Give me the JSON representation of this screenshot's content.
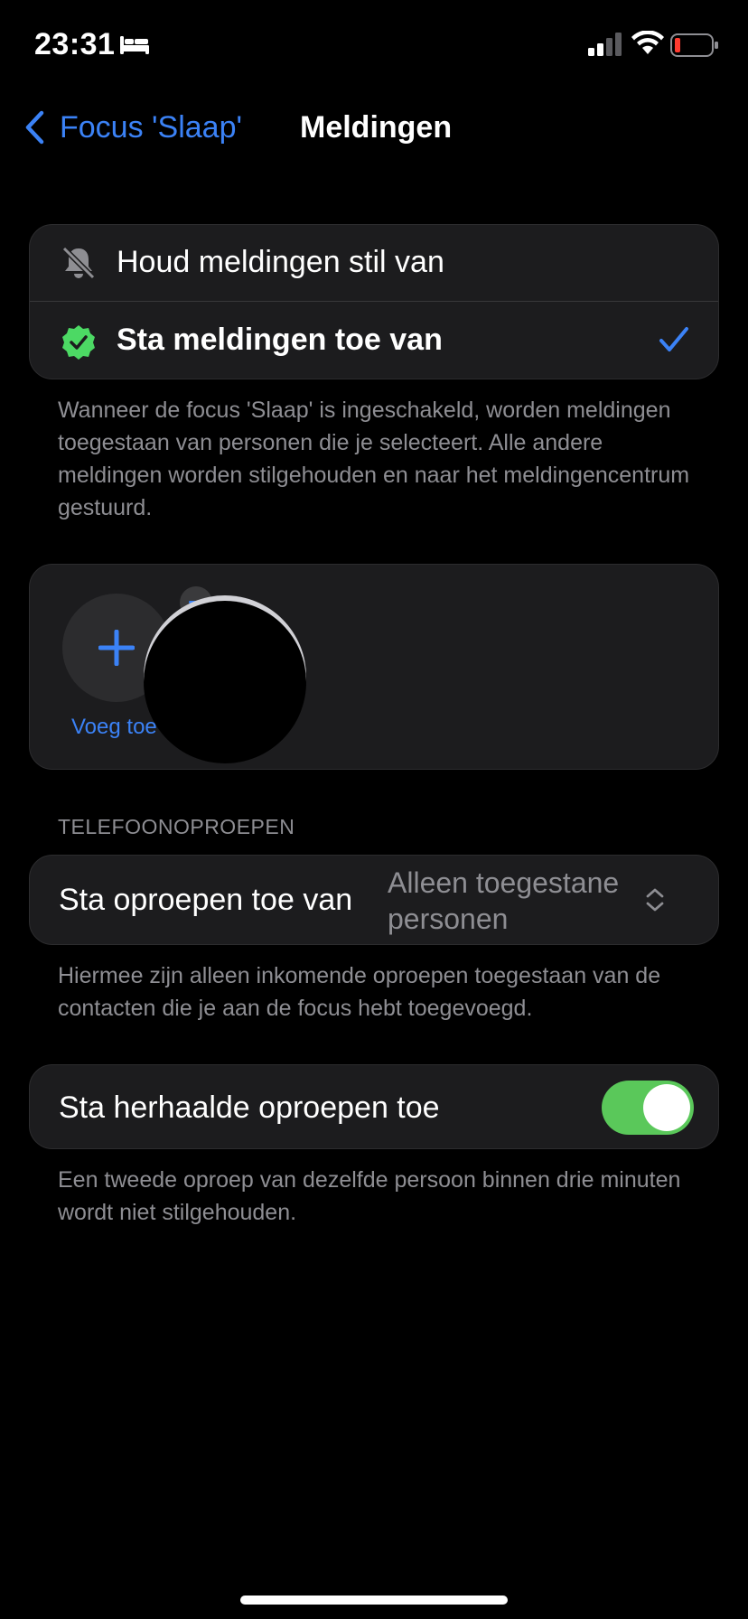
{
  "status_bar": {
    "time": "23:31"
  },
  "nav": {
    "back_label": "Focus 'Slaap'",
    "title": "Meldingen"
  },
  "notification_mode": {
    "options": [
      {
        "label": "Houd meldingen stil van",
        "selected": false
      },
      {
        "label": "Sta meldingen toe van",
        "selected": true
      }
    ],
    "footer": "Wanneer de focus 'Slaap' is ingeschakeld, worden meldingen toegestaan van personen die je selecteert. Alle andere meldingen worden stilgehouden en naar het meldingencentrum gestuurd."
  },
  "people": {
    "add_label": "Voeg toe"
  },
  "calls": {
    "section_header": "TELEFOONOPROEPEN",
    "allow_calls_label": "Sta oproepen toe van",
    "allow_calls_value": "Alleen toegestane personen",
    "footer": "Hiermee zijn alleen inkomende oproepen toegestaan van de contacten die je aan de focus hebt toegevoegd."
  },
  "repeated_calls": {
    "label": "Sta herhaalde oproepen toe",
    "enabled": true,
    "footer": "Een tweede oproep van dezelfde persoon binnen drie minuten wordt niet stilgehouden."
  },
  "colors": {
    "accent": "#3b82f6",
    "toggle_on": "#5ac85a",
    "check_badge": "#4cd964"
  }
}
